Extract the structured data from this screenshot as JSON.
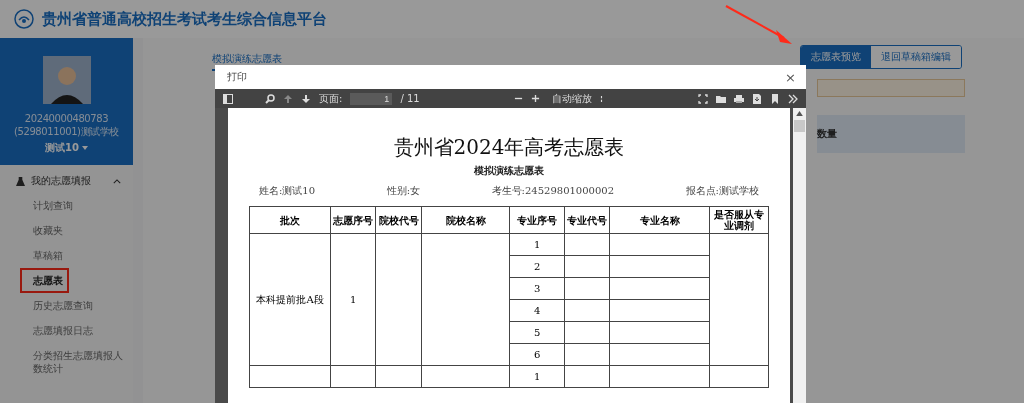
{
  "header": {
    "title": "贵州省普通高校招生考试考生综合信息平台"
  },
  "profile": {
    "id": "20240000480783",
    "school": "(5298011001)测试学校",
    "name": "测试10"
  },
  "menu": {
    "group": "我的志愿填报",
    "expanded": true,
    "items": [
      {
        "label": "计划查询",
        "selected": false,
        "highlighted": false
      },
      {
        "label": "收藏夹",
        "selected": false,
        "highlighted": false
      },
      {
        "label": "草稿箱",
        "selected": false,
        "highlighted": false
      },
      {
        "label": "志愿表",
        "selected": true,
        "highlighted": true
      },
      {
        "label": "历史志愿查询",
        "selected": false,
        "highlighted": false
      },
      {
        "label": "志愿填报日志",
        "selected": false,
        "highlighted": false
      },
      {
        "label": "分类招生志愿填报人数统计",
        "selected": false,
        "highlighted": false
      }
    ]
  },
  "tab": {
    "label": "模拟演练志愿表",
    "selected": true
  },
  "actions": [
    {
      "label": "志愿表预览",
      "selected": true
    },
    {
      "label": "退回草稿箱编辑",
      "selected": false
    }
  ],
  "card": {
    "label": "数量"
  },
  "annotations": [
    {
      "kind": "arrow"
    }
  ],
  "dialog": {
    "title": "打印",
    "close": "×",
    "viewer": {
      "page_label": "页面:",
      "page": "1",
      "page_count": "/ 11",
      "zoom": "自动缩放"
    },
    "document": {
      "title": "贵州省2024年高考志愿表",
      "subtitle": "模拟演练志愿表",
      "info": [
        "姓名:测试10",
        "性别:女",
        "考生号:24529801000002",
        "报名点:测试学校"
      ],
      "columns": [
        "批次",
        "志愿序号",
        "院校代号",
        "院校名称",
        "专业序号",
        "专业代号",
        "专业名称",
        "是否服从专业调剂"
      ],
      "groups": [
        {
          "batch": "本科提前批A段",
          "order": "1",
          "majors": [
            "1",
            "2",
            "3",
            "4",
            "5",
            "6"
          ]
        },
        {
          "majors": [
            "1"
          ]
        }
      ]
    }
  }
}
